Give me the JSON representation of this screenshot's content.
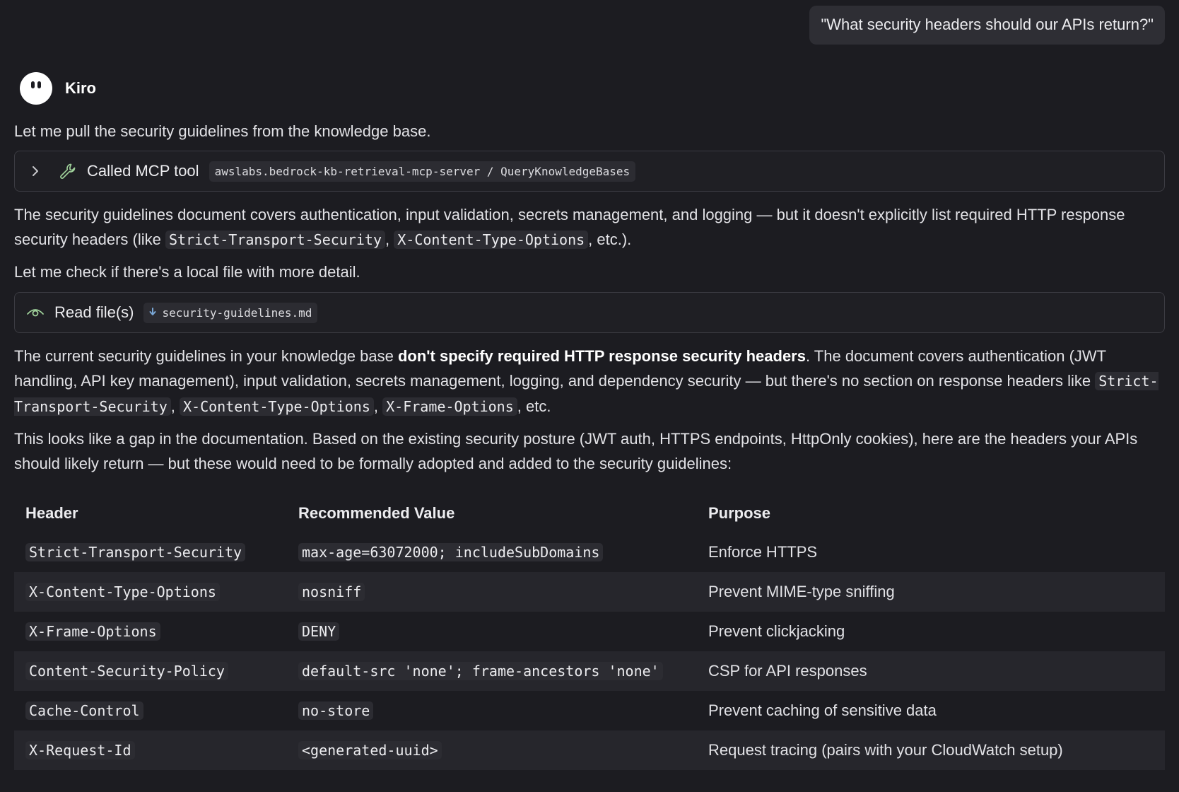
{
  "user_message": "\"What security headers should our APIs return?\"",
  "assistant": {
    "name": "Kiro",
    "intro": "Let me pull the security guidelines from the knowledge base.",
    "tool_call": {
      "label": "Called MCP tool",
      "tool": "awslabs.bedrock-kb-retrieval-mcp-server / QueryKnowledgeBases"
    },
    "para1": {
      "a": "The security guidelines document covers authentication, input validation, secrets management, and logging — but it doesn't explicitly list required HTTP response security headers (like ",
      "code1": "Strict-Transport-Security",
      "b": ", ",
      "code2": "X-Content-Type-Options",
      "c": ", etc.)."
    },
    "para2": "Let me check if there's a local file with more detail.",
    "read_file": {
      "label": "Read file(s)",
      "file": "security-guidelines.md"
    },
    "para3": {
      "a": "The current security guidelines in your knowledge base ",
      "bold": "don't specify required HTTP response security headers",
      "b": ". The document covers authentication (JWT handling, API key management), input validation, secrets management, logging, and dependency security — but there's no section on response headers like ",
      "code1": "Strict-Transport-Security",
      "sep1": ", ",
      "code2": "X-Content-Type-Options",
      "sep2": ", ",
      "code3": "X-Frame-Options",
      "c": ", etc."
    },
    "para4": "This looks like a gap in the documentation. Based on the existing security posture (JWT auth, HTTPS endpoints, HttpOnly cookies), here are the headers your APIs should likely return — but these would need to be formally adopted and added to the security guidelines:",
    "table": {
      "columns": [
        "Header",
        "Recommended Value",
        "Purpose"
      ],
      "rows": [
        {
          "header": "Strict-Transport-Security",
          "value": "max-age=63072000; includeSubDomains",
          "purpose": "Enforce HTTPS"
        },
        {
          "header": "X-Content-Type-Options",
          "value": "nosniff",
          "purpose": "Prevent MIME-type sniffing"
        },
        {
          "header": "X-Frame-Options",
          "value": "DENY",
          "purpose": "Prevent clickjacking"
        },
        {
          "header": "Content-Security-Policy",
          "value": "default-src 'none'; frame-ancestors 'none'",
          "purpose": "CSP for API responses"
        },
        {
          "header": "Cache-Control",
          "value": "no-store",
          "purpose": "Prevent caching of sensitive data"
        },
        {
          "header": "X-Request-Id",
          "value": "<generated-uuid>",
          "purpose": "Request tracing (pairs with your CloudWatch setup)"
        }
      ]
    }
  }
}
